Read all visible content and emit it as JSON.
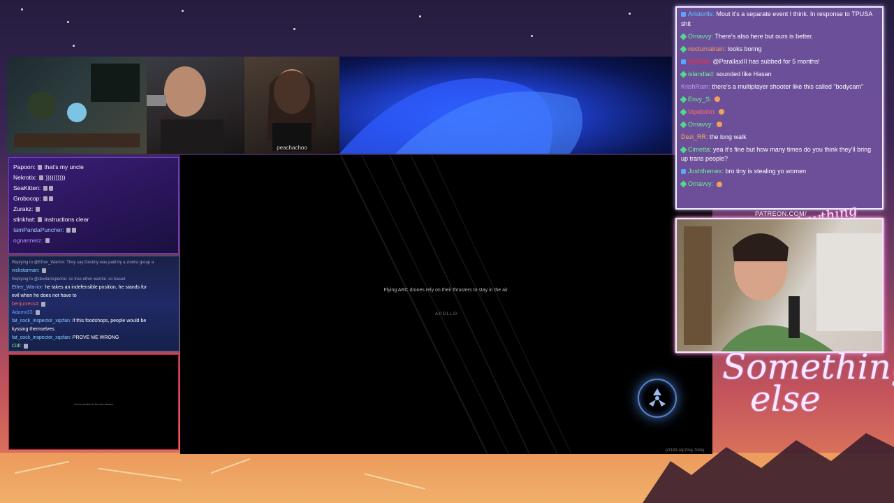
{
  "webcams": {
    "cam3_label": "peachachoo"
  },
  "left_chat_top": {
    "messages": [
      {
        "user": "Papoon:",
        "text": "that's my uncle",
        "user_color": "#ffffff"
      },
      {
        "user": "Nekrotix:",
        "text": "))))))))))",
        "user_color": "#ffffff"
      },
      {
        "user": "SeaKitten:",
        "text": "",
        "user_color": "#ffffff"
      },
      {
        "user": "Grobocop:",
        "text": "",
        "user_color": "#ffffff"
      },
      {
        "user": "Zurakz:",
        "text": "",
        "user_color": "#ffffff"
      },
      {
        "user": "stinkhat:",
        "text": "instructions clear",
        "user_color": "#ffffff"
      },
      {
        "user": "IamPandaPuncher:",
        "text": "",
        "user_color": "#9ad0ff"
      },
      {
        "user": "ognannerz:",
        "text": "",
        "user_color": "#b38cff"
      }
    ]
  },
  "left_chat_mid": {
    "lines": [
      {
        "reply": "Replying to @Ether_Warrior: They say Destiny was paid by a zionist group a"
      },
      {
        "user": "nickstarman:",
        "text": "",
        "user_color": "#7fd3ff"
      },
      {
        "reply": "Replying to @devilantspectre: so true ether warrior. so based"
      },
      {
        "user": "Ether_Warrior:",
        "text": "he takes an indefensible position, he stands for",
        "user_color": "#8fb7ff"
      },
      {
        "text_only": "evil when he does not have to"
      },
      {
        "user": "benjuniecs4:",
        "text": "",
        "user_color": "#ff5d73"
      },
      {
        "user": "Adamx33:",
        "text": "",
        "user_color": "#62a4ff"
      },
      {
        "user": "fat_cock_inspector_xqcfan:",
        "text": "if this foodshops, people would be",
        "user_color": "#7fd3ff"
      },
      {
        "text_only": "kyssing themselves"
      },
      {
        "user": "fat_cock_inspector_xqcfan:",
        "text": "PROVE ME WRONG",
        "user_color": "#7fd3ff"
      },
      {
        "user": "Cidl:",
        "text": "",
        "user_color": "#7cff7c"
      }
    ]
  },
  "left_chat_bottom": {
    "message": "You're deafed to the live stream"
  },
  "game": {
    "tip": "Flying ARC drones rely on their thrusters to stay in the air.",
    "title": "APOLLO",
    "code": "p3183-mp7mg-7ddxj"
  },
  "right_chat": {
    "messages": [
      {
        "user": "Aristortle:",
        "text": "Mout it's a separate event I think. In response to TPUSA shit",
        "user_color": "#5cc8ff",
        "badge": "blue"
      },
      {
        "user": "Ornavvy:",
        "text": "There's also here but ours is better.",
        "user_color": "#6ff09a",
        "badge": "gem"
      },
      {
        "user": "nocturnalrain:",
        "text": "looks boring",
        "user_color": "#ff9c5e",
        "badge": "gem"
      },
      {
        "user": "KickBot:",
        "text": "@ParallaxIII has subbed for 5 months!",
        "user_color": "#ff2b3d",
        "badge": "blue"
      },
      {
        "user": "islandlad:",
        "text": "sounded like Hasan",
        "user_color": "#6ff09a",
        "badge": "gem"
      },
      {
        "user": "KrishRam:",
        "text": "there's a multiplayer shooter like this called \"bodycam\"",
        "user_color": "#c49bff",
        "badge": "none"
      },
      {
        "user": "Envy_S:",
        "text": "",
        "user_color": "#6ff09a",
        "badge": "gem",
        "emote": true
      },
      {
        "user": "Vipebolm:",
        "text": "",
        "user_color": "#ff6d6d",
        "badge": "gem",
        "emote": true
      },
      {
        "user": "Ornavvy:",
        "text": "",
        "user_color": "#6ff09a",
        "badge": "gem",
        "emote": true
      },
      {
        "user": "Dezi_RR:",
        "text": "the long walk",
        "user_color": "#ffb45a",
        "badge": "none"
      },
      {
        "user": "Cimetta:",
        "text": "yea it's fine but how many times do you think they'll bring up trans people?",
        "user_color": "#6ff09a",
        "badge": "gem"
      },
      {
        "user": "Joshthemex:",
        "text": "bro tiny is stealing yo women",
        "user_color": "#6ff09a",
        "badge": "blue"
      },
      {
        "user": "Ornavvy:",
        "text": "",
        "user_color": "#6ff09a",
        "badge": "gem",
        "emote": true
      }
    ]
  },
  "branding": {
    "patreon": "PATREON.COM/",
    "small_logo": "Anything else?",
    "big_logo_line1": "Something",
    "big_logo_line2": "else"
  },
  "colors": {
    "sky_top": "#241c3e",
    "sand": "#ec9a5c",
    "chat_right_bg": "#6b4f99"
  }
}
